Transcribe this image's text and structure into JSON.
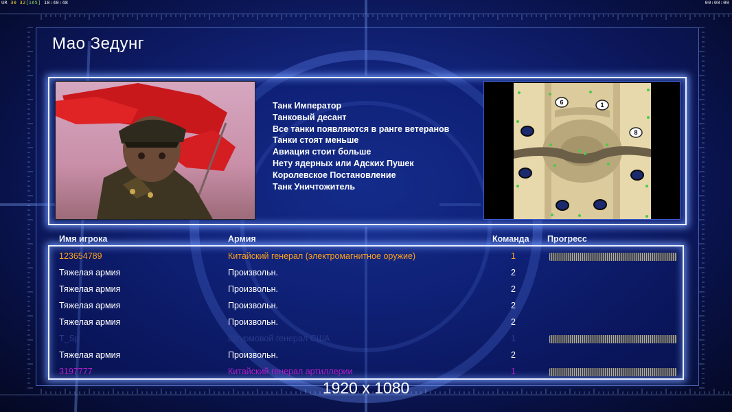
{
  "hud": {
    "left_prefix": "UR",
    "left_v1": "30",
    "left_v2": "32",
    "left_v3": "[165]",
    "left_time": "18:40:48",
    "right_timer": "00:00:00"
  },
  "general": {
    "title": "Мао Зедунг",
    "perks": [
      "Танк Император",
      "Танковый десант",
      "Все танки появляются в ранге ветеранов",
      "Танки стоят меньше",
      "Авиация стоит больше",
      "Нету ядерных или Адских Пушек",
      "Королевское Постановление",
      "Танк Уничтожитель"
    ]
  },
  "minimap": {
    "start_labels": [
      "6",
      "1",
      "8"
    ]
  },
  "table": {
    "headers": {
      "name": "Имя игрока",
      "army": "Армия",
      "team": "Команда",
      "progress": "Прогресс"
    },
    "rows": [
      {
        "name": "123654789",
        "army": "Китайский генерал (электромагнитное оружие)",
        "team": "1",
        "style": "orange",
        "progress": 1
      },
      {
        "name": "Тяжелая армия",
        "army": "Произвольн.",
        "team": "2",
        "style": "white",
        "progress": null
      },
      {
        "name": "Тяжелая армия",
        "army": "Произвольн.",
        "team": "2",
        "style": "white",
        "progress": null
      },
      {
        "name": "Тяжелая армия",
        "army": "Произвольн.",
        "team": "2",
        "style": "white",
        "progress": null
      },
      {
        "name": "Тяжелая армия",
        "army": "Произвольн.",
        "team": "2",
        "style": "white",
        "progress": null
      },
      {
        "name": "T_Sp",
        "army": "Штурмовой генерал США",
        "team": "1",
        "style": "dim",
        "progress": 1
      },
      {
        "name": "Тяжелая армия",
        "army": "Произвольн.",
        "team": "2",
        "style": "white",
        "progress": null
      },
      {
        "name": "3197777",
        "army": "Китайский генерал артиллерии",
        "team": "1",
        "style": "magenta",
        "progress": 1
      }
    ]
  },
  "resolution_label": "1920 x 1080",
  "colors": {
    "orange_player": "#ffa21e",
    "magenta_player": "#b020c8",
    "dim_player": "#2a3a8a",
    "frame_glow": "#e8eeff"
  }
}
